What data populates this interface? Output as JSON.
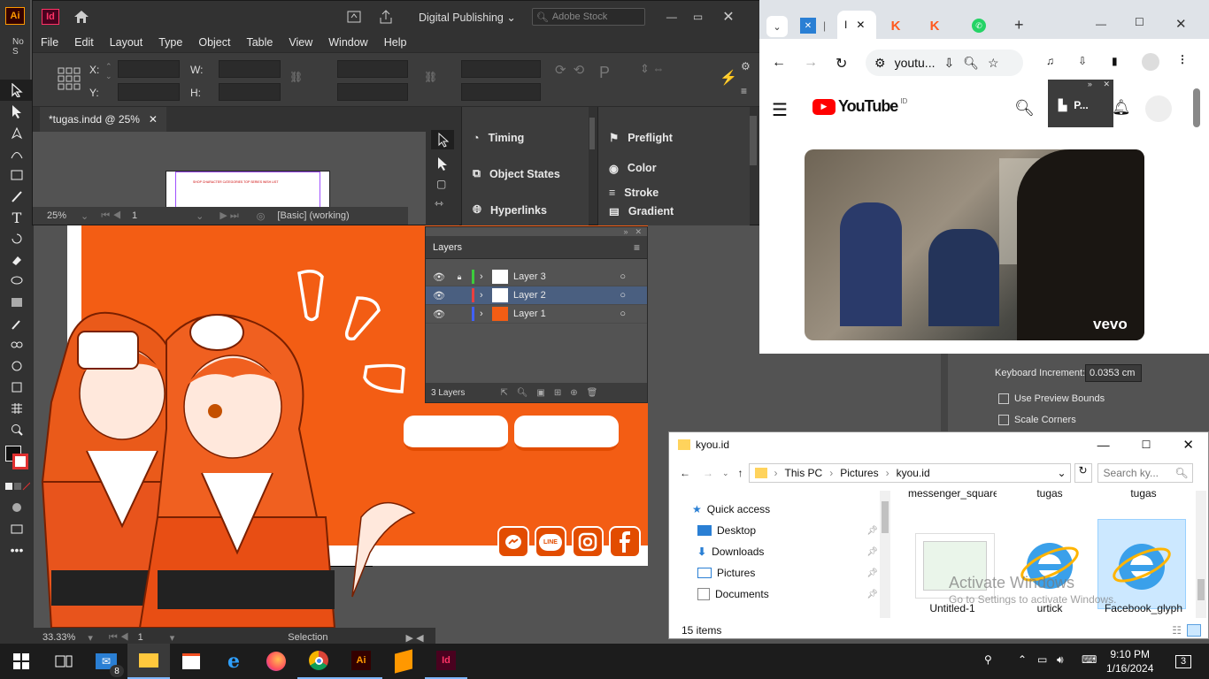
{
  "illustrator": {
    "no_selection_label": "No S",
    "status_zoom": "33.33%",
    "status_page": "1",
    "status_tool": "Selection"
  },
  "indesign": {
    "logo": "Id",
    "workspace": "Digital Publishing",
    "stock_search_placeholder": "Adobe Stock",
    "menu": [
      "File",
      "Edit",
      "Layout",
      "Type",
      "Object",
      "Table",
      "View",
      "Window",
      "Help"
    ],
    "control": {
      "x_label": "X:",
      "y_label": "Y:",
      "w_label": "W:",
      "h_label": "H:"
    },
    "doc_tab": "*tugas.indd @ 25%",
    "zoom": "25%",
    "page": "1",
    "style_label": "[Basic] (working)",
    "panels_mid": [
      "Timing",
      "Object States",
      "Hyperlinks"
    ],
    "panels_right": [
      "Preflight",
      "Color",
      "Stroke",
      "Gradient"
    ]
  },
  "layers_panel": {
    "title": "Layers",
    "layers": [
      {
        "name": "Layer 3",
        "color": "#3ccc3c",
        "locked": true
      },
      {
        "name": "Layer 2",
        "color": "#e94040",
        "locked": false,
        "selected": true
      },
      {
        "name": "Layer 1",
        "color": "#4060ff",
        "locked": false
      }
    ],
    "count": "3 Layers"
  },
  "artwork": {
    "social_icons": [
      "messenger-icon",
      "line-icon",
      "instagram-icon",
      "facebook-icon"
    ],
    "line_label": "LINE",
    "header_menu": "SHOP  CHARACTER  CATEGORIES  TOP SERIES  WISH LIST"
  },
  "prefs": {
    "keyboard_increment_label": "Keyboard Increment:",
    "keyboard_increment_value": "0.0353 cm",
    "use_preview_bounds": "Use Preview Bounds",
    "scale_corners": "Scale Corners"
  },
  "browser": {
    "tab_active_label": "I",
    "url": "youtu...",
    "youtube_logo": "YouTube",
    "region": "ID",
    "pip_label": "P...",
    "video_watermark": "vevo"
  },
  "explorer": {
    "title": "kyou.id",
    "breadcrumb": [
      "This PC",
      "Pictures",
      "kyou.id"
    ],
    "search_placeholder": "Search ky...",
    "nav": [
      {
        "label": "Quick access",
        "icon": "star-icon"
      },
      {
        "label": "Desktop",
        "icon": "desktop-icon",
        "pinned": true
      },
      {
        "label": "Downloads",
        "icon": "download-icon",
        "pinned": true
      },
      {
        "label": "Pictures",
        "icon": "pictures-icon",
        "pinned": true
      },
      {
        "label": "Documents",
        "icon": "documents-icon",
        "pinned": true
      }
    ],
    "top_names": [
      "messenger_square",
      "tugas",
      "tugas"
    ],
    "files": [
      "Untitled-1",
      "urtick",
      "Facebook_glyph"
    ],
    "item_count": "15 items",
    "watermark_title": "Activate Windows",
    "watermark_sub": "Go to Settings to activate Windows."
  },
  "taskbar": {
    "mail_badge": "8",
    "time": "9:10 PM",
    "date": "1/16/2024",
    "ai_label": "Ai",
    "id_label": "Id",
    "notif_count": "3"
  },
  "colors": {
    "orange": "#f35d14",
    "id_pink": "#ff3366",
    "ai_orange": "#ff9a00"
  }
}
